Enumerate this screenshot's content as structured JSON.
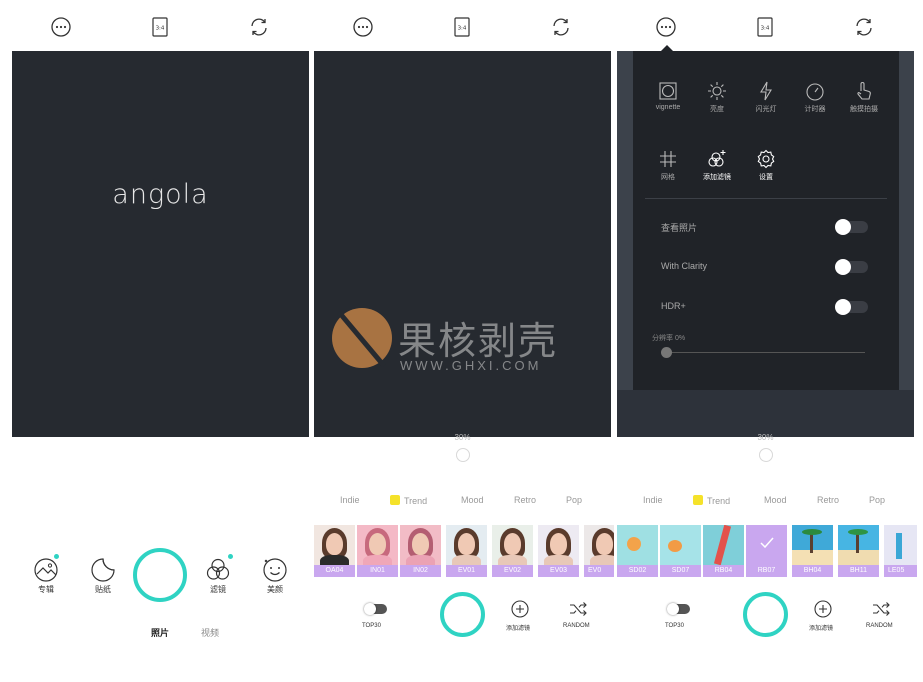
{
  "screen1": {
    "viewfinder_text": "angola",
    "tools": [
      {
        "label": "专辑",
        "icon": "album-icon"
      },
      {
        "label": "贴纸",
        "icon": "sticker-icon"
      },
      {
        "label": "滤镜",
        "icon": "filter-icon"
      },
      {
        "label": "美颜",
        "icon": "beauty-icon"
      }
    ],
    "modes": [
      {
        "label": "照片",
        "active": true
      },
      {
        "label": "视频",
        "active": false
      }
    ]
  },
  "screen2": {
    "percent": "30%",
    "tabs": [
      "Indie",
      "Trend",
      "Mood",
      "Retro",
      "Pop"
    ],
    "active_tab": "Trend",
    "filters": [
      "OA04",
      "IN01",
      "IN02",
      "EV01",
      "EV02",
      "EV03",
      "EV0"
    ],
    "top30_label": "TOP30",
    "add_filter_label": "添加滤镜",
    "random_label": "RANDOM"
  },
  "screen3": {
    "percent": "30%",
    "tabs": [
      "Indie",
      "Trend",
      "Mood",
      "Retro",
      "Pop"
    ],
    "filters": [
      "SD02",
      "SD07",
      "RB04",
      "RB07",
      "BH04",
      "BH11",
      "LE05"
    ],
    "selected_filter": "RB07",
    "top30_label": "TOP30",
    "add_filter_label": "添加滤镜",
    "random_label": "RANDOM",
    "popup": {
      "row1": [
        {
          "label": "vignette",
          "icon": "vignette-icon"
        },
        {
          "label": "亮度",
          "icon": "brightness-icon"
        },
        {
          "label": "闪光灯",
          "icon": "flash-icon"
        },
        {
          "label": "计时器",
          "icon": "timer-icon"
        },
        {
          "label": "触摸拍摄",
          "icon": "touch-icon"
        }
      ],
      "row2": [
        {
          "label": "网格",
          "icon": "grid-icon"
        },
        {
          "label": "添加滤镜",
          "icon": "add-filter-icon"
        },
        {
          "label": "设置",
          "icon": "settings-icon"
        }
      ],
      "settings": [
        {
          "label": "查看照片",
          "on": false
        },
        {
          "label": "With Clarity",
          "on": false
        },
        {
          "label": "HDR+",
          "on": false
        }
      ],
      "resolution_label": "分辨率 0%",
      "resolution_value": 0
    }
  },
  "topbar": {
    "aspect_label": "3:4"
  },
  "watermark": {
    "cn": "果核剥壳",
    "en": "WWW.GHXI.COM"
  },
  "colors": {
    "accent": "#2fd3c3",
    "viewfinder": "#262a30",
    "filter_caption": "#c9a7ef",
    "trend_badge": "#f5e22a"
  }
}
